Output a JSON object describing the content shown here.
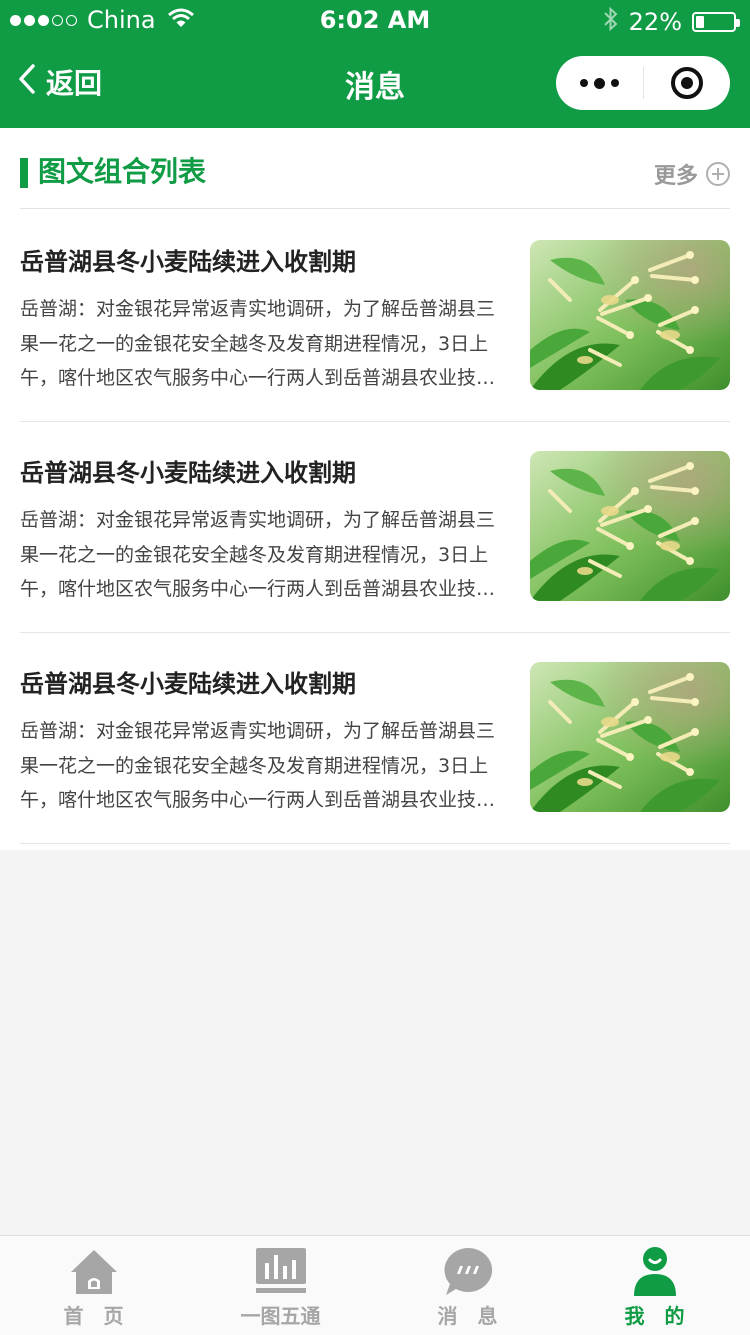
{
  "status_bar": {
    "carrier": "China",
    "time": "6:02 AM",
    "battery": "22%",
    "battery_level": 0.22
  },
  "nav": {
    "back_label": "返回",
    "title": "消息"
  },
  "section": {
    "title": "图文组合列表",
    "more_label": "更多"
  },
  "articles": [
    {
      "title": "岳普湖县冬小麦陆续进入收割期",
      "summary": "岳普湖：对金银花异常返青实地调研，为了解岳普湖县三果一花之一的金银花安全越冬及发育期进程情况，3日上午，喀什地区农气服务中心一行两人到岳普湖县农业技术推广中心进行调研"
    },
    {
      "title": "岳普湖县冬小麦陆续进入收割期",
      "summary": "岳普湖：对金银花异常返青实地调研，为了解岳普湖县三果一花之一的金银花安全越冬及发育期进程情况，3日上午，喀什地区农气服务中心一行两人到岳普湖县农业技术推广中心进行调研"
    },
    {
      "title": "岳普湖县冬小麦陆续进入收割期",
      "summary": "岳普湖：对金银花异常返青实地调研，为了解岳普湖县三果一花之一的金银花安全越冬及发育期进程情况，3日上午，喀什地区农气服务中心一行两人到岳普湖县农业技术推广中心进行调研"
    }
  ],
  "tabbar": {
    "items": [
      {
        "label": "首　页",
        "icon": "home-icon"
      },
      {
        "label": "一图五通",
        "icon": "bar-chart-icon"
      },
      {
        "label": "消　息",
        "icon": "message-icon"
      },
      {
        "label": "我　的",
        "icon": "user-icon"
      }
    ],
    "active_index": 3
  },
  "colors": {
    "brand": "#109b45",
    "inactive": "#a6a6a6"
  }
}
